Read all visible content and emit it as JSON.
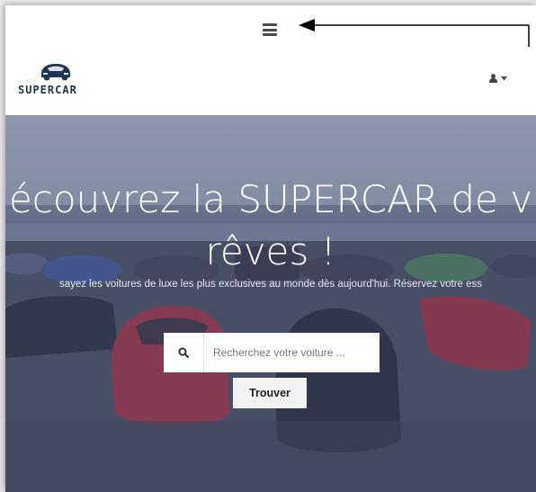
{
  "header": {
    "logo_text": "SUPERCAR"
  },
  "hero": {
    "title_line1": "écouvrez la SUPERCAR de v",
    "title_line2": "rêves !",
    "subtitle": "sayez les voitures de luxe les plus exclusives au monde dès aujourd'hui. Réservez votre ess"
  },
  "search": {
    "placeholder": "Recherchez votre voiture ...",
    "button_label": "Trouver"
  },
  "icons": {
    "menu": "hamburger-icon",
    "user": "user-icon",
    "caret": "caret-down-icon",
    "search": "search-icon",
    "logo": "car-logo-icon"
  },
  "colors": {
    "hero_overlay": "#4a4f6e",
    "logo": "#1f3552",
    "menu_icon": "#4a4a52"
  }
}
